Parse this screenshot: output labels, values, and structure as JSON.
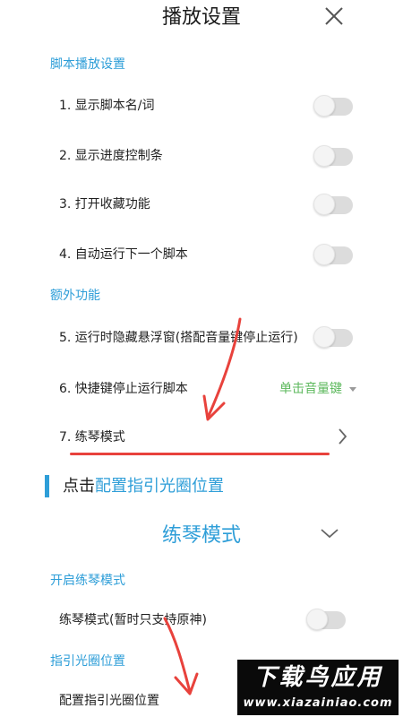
{
  "header": {
    "title": "播放设置",
    "close_icon": "close-icon"
  },
  "sections": {
    "script_playback": "脚本播放设置",
    "extra_functions": "额外功能",
    "practice_enable": "开启练琴模式",
    "guide_ring": "指引光圈位置"
  },
  "rows": [
    {
      "label": "1. 显示脚本名/词",
      "enabled": false
    },
    {
      "label": "2. 显示进度控制条",
      "enabled": false
    },
    {
      "label": "3. 打开收藏功能",
      "enabled": false
    },
    {
      "label": "4. 自动运行下一个脚本",
      "enabled": false
    },
    {
      "label": "5. 运行时隐藏悬浮窗(搭配音量键停止运行)",
      "enabled": false
    },
    {
      "label": "6. 快捷键停止运行脚本",
      "value": "单击音量键"
    },
    {
      "label": "7. 练琴模式"
    }
  ],
  "tip": {
    "prefix": "点击",
    "link": "配置指引光圈位置"
  },
  "practice_panel": {
    "title": "练琴模式",
    "practice_row": {
      "label": "练琴模式(暂时只支持原神)",
      "enabled": false
    },
    "config_row": {
      "label": "配置指引光圈位置"
    }
  },
  "watermark": {
    "logo": "下载鸟应用",
    "url": "www.xiazainiao.com"
  },
  "colors": {
    "accent": "#2e9ed8",
    "dropdown_value": "#5cb85c",
    "annotation_red": "#e8423c",
    "toggle_off_track": "#dcdcdc"
  }
}
